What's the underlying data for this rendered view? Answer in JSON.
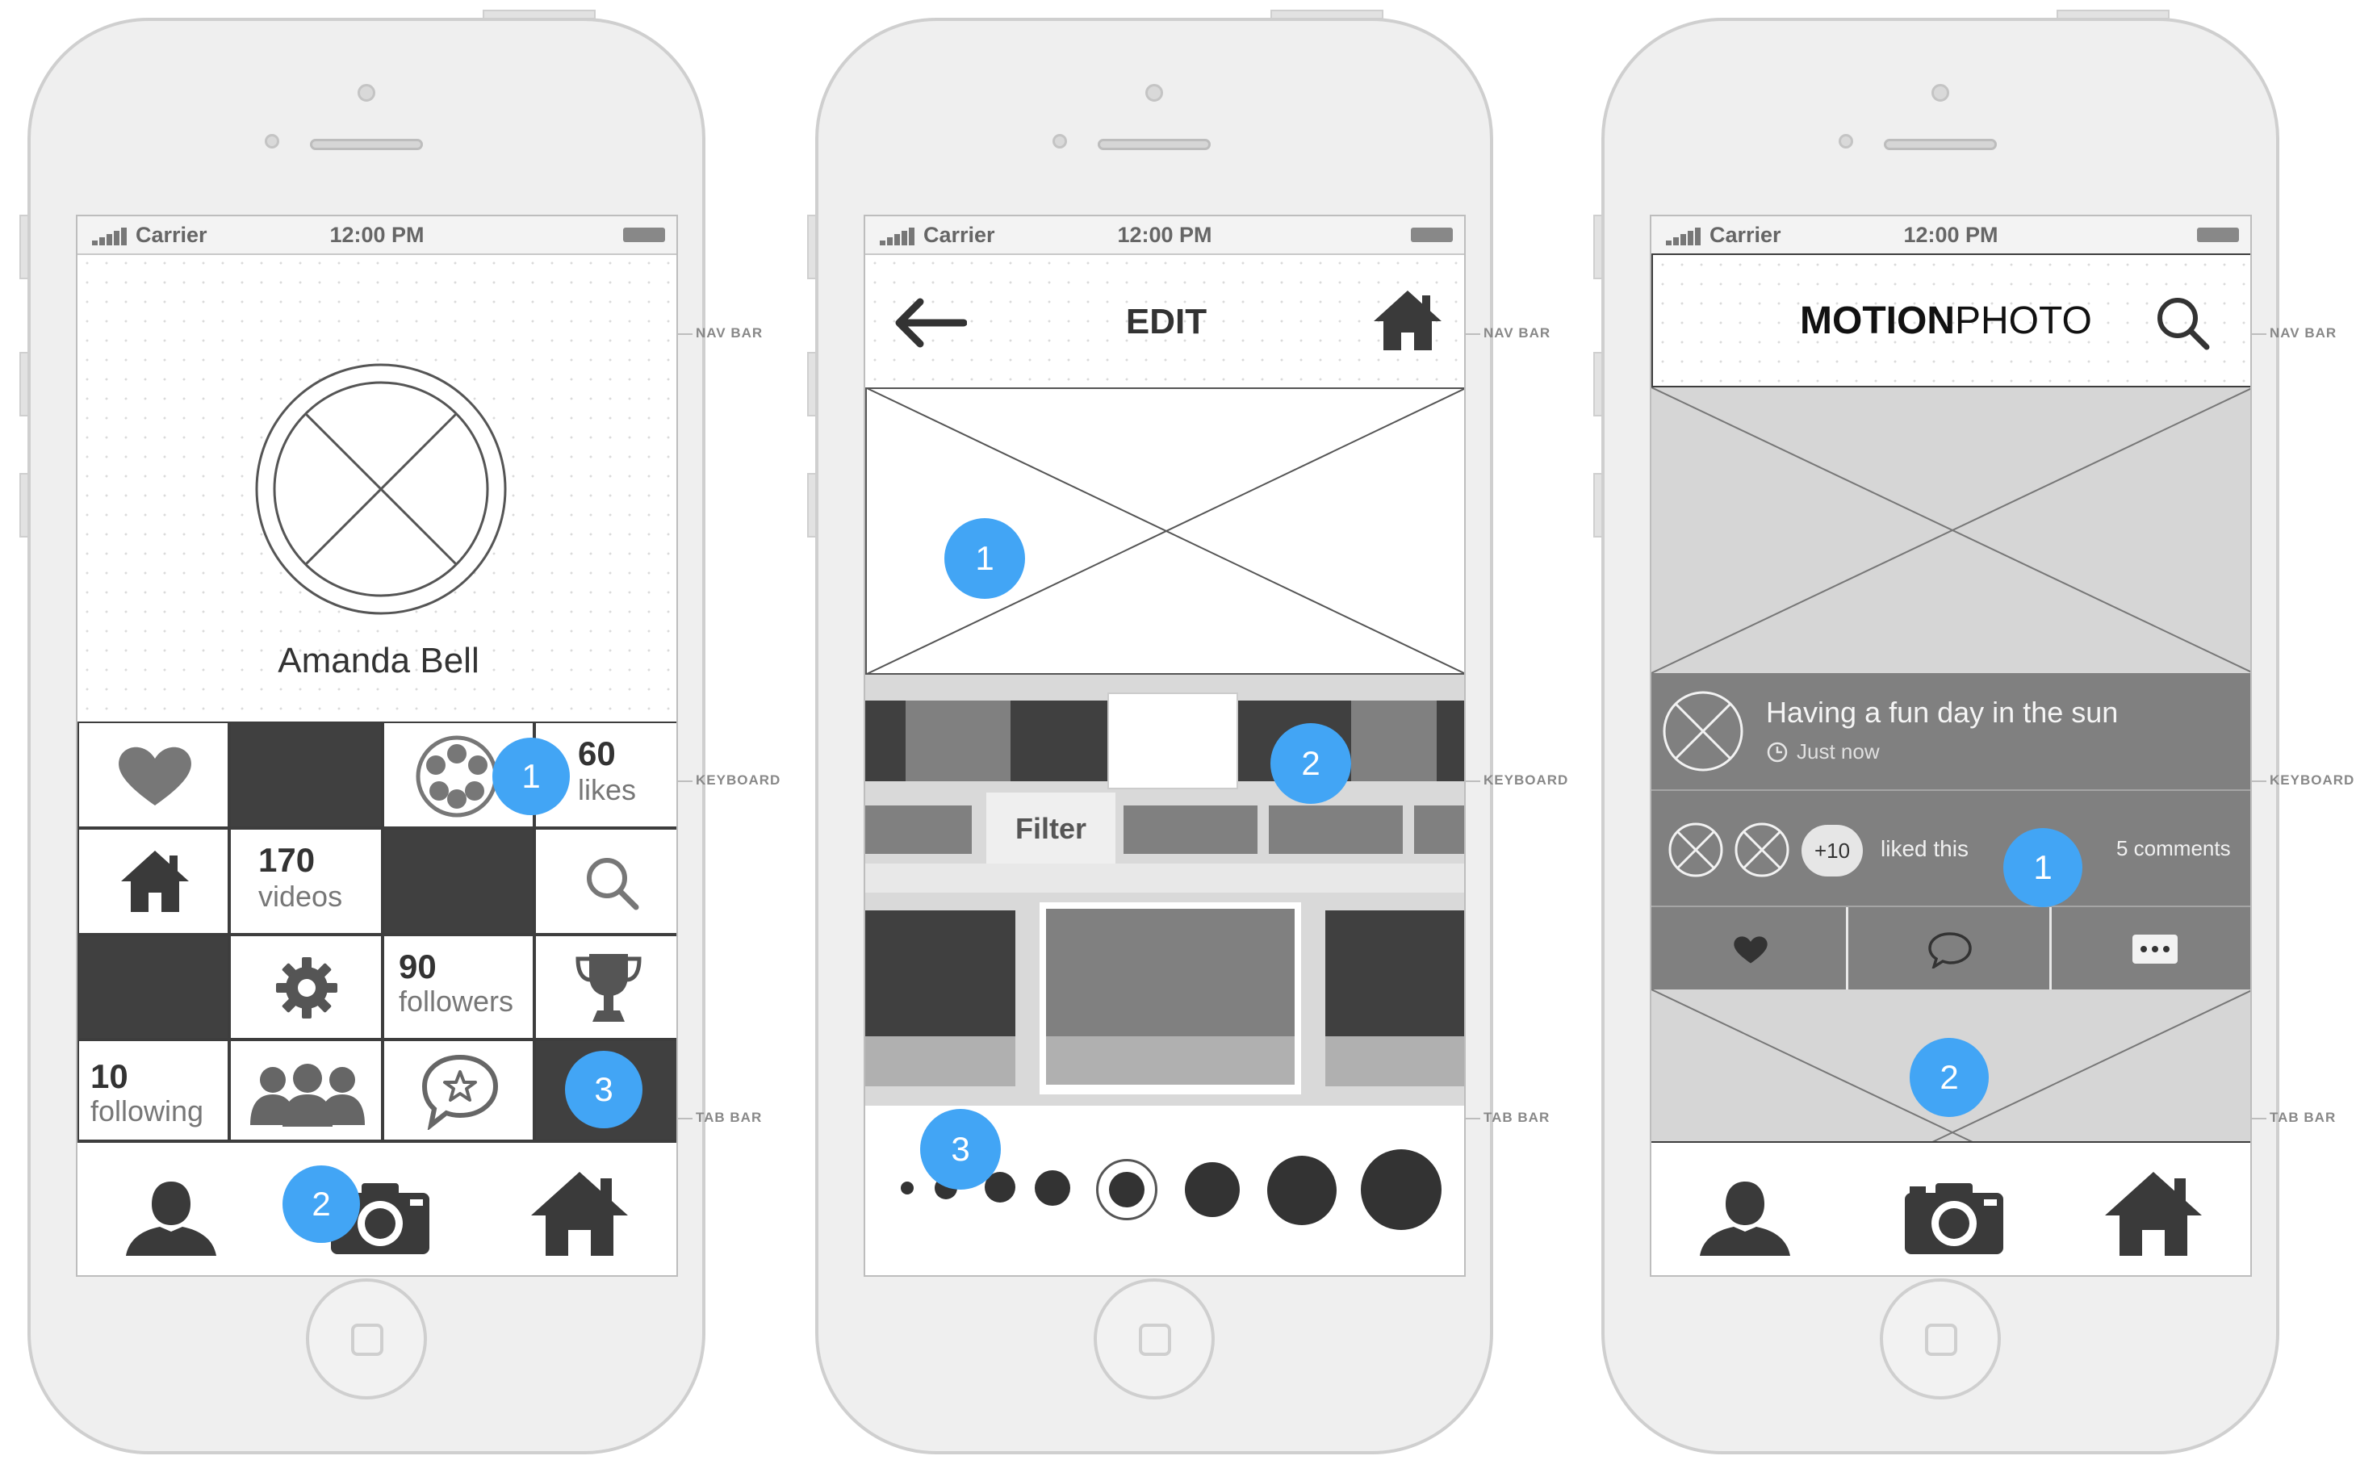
{
  "annotations": {
    "nav_bar": "NAV BAR",
    "keyboard": "KEYBOARD",
    "tab_bar": "TAB BAR"
  },
  "status": {
    "carrier": "Carrier",
    "time": "12:00 PM"
  },
  "phone1": {
    "profile_name": "Amanda Bell",
    "stats": {
      "likes_num": "60",
      "likes_label": "likes",
      "videos_num": "170",
      "videos_label": "videos",
      "followers_num": "90",
      "followers_label": "followers",
      "following_num": "10",
      "following_label": "following"
    },
    "badges": [
      "1",
      "2",
      "3"
    ]
  },
  "phone2": {
    "title": "EDIT",
    "filter_tab": "Filter",
    "badges": [
      "1",
      "2",
      "3"
    ]
  },
  "phone3": {
    "brand_bold": "MOTION",
    "brand_light": "PHOTO",
    "post_title": "Having a fun day in the sun",
    "post_time": "Just now",
    "likes_extra": "+10",
    "liked_text": "liked this",
    "comments": "5 comments",
    "badges": [
      "1",
      "2"
    ]
  },
  "colors": {
    "badge": "#42a5f5",
    "dark": "#404040",
    "mid": "#808080",
    "light": "#d6d6d6"
  }
}
